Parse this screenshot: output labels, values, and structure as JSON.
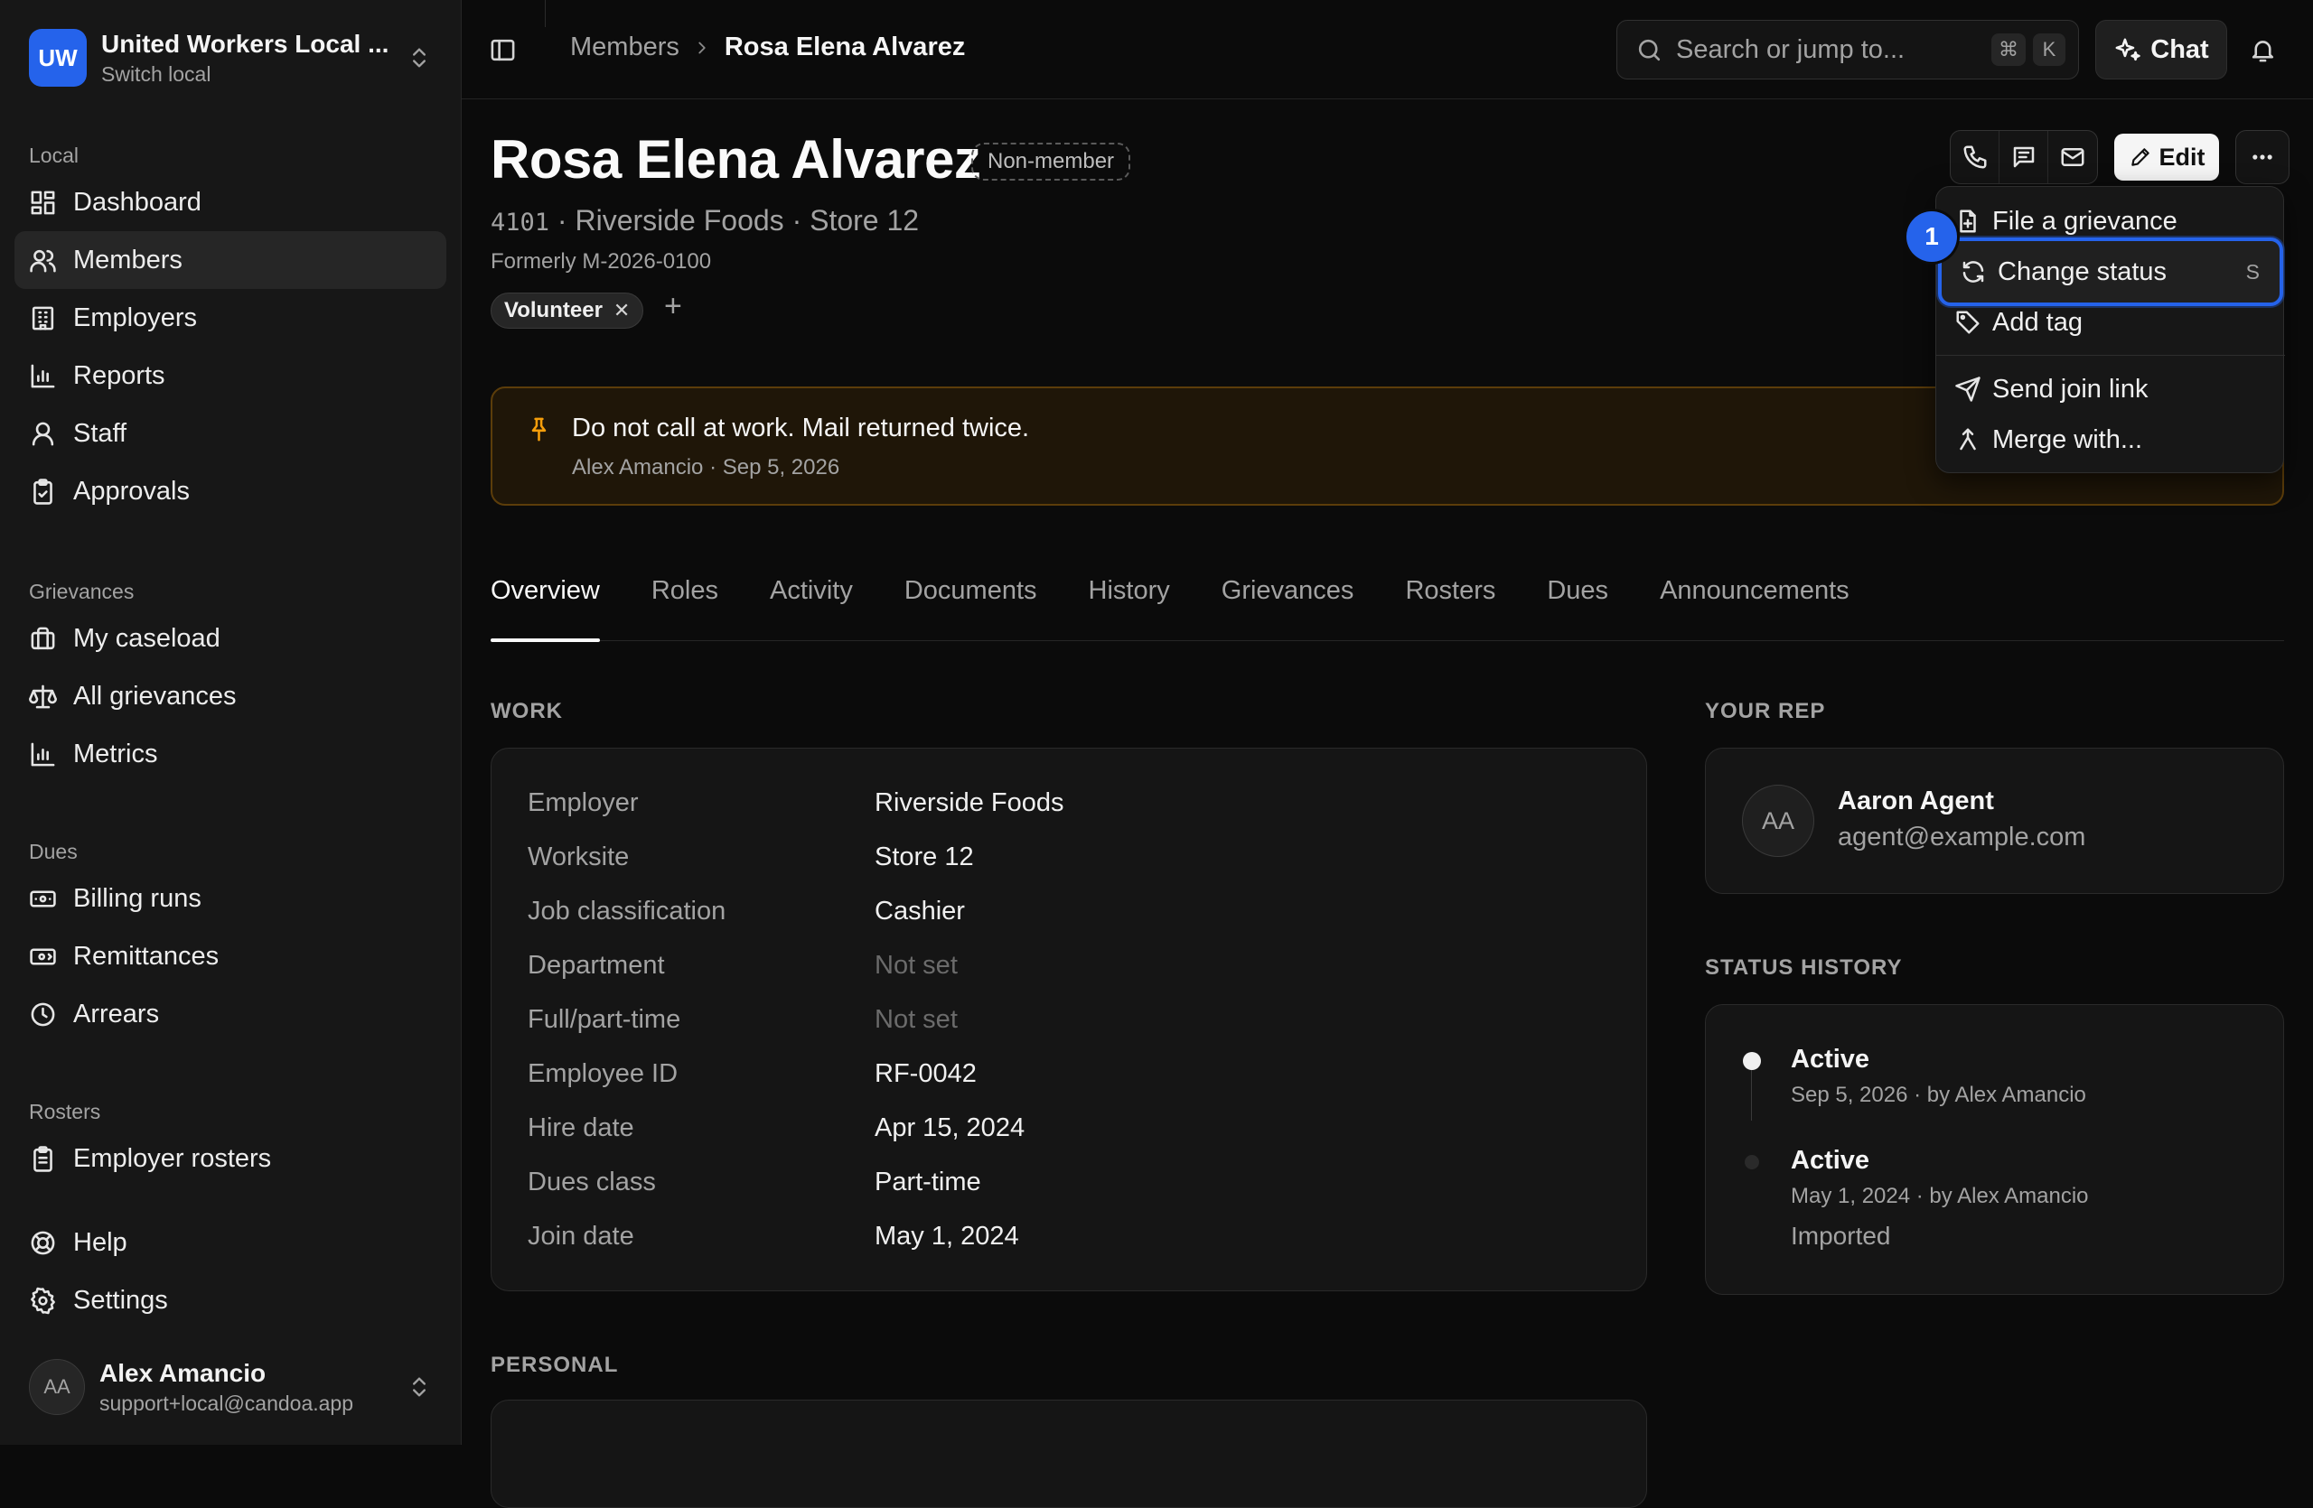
{
  "org": {
    "initials": "UW",
    "name": "United Workers Local ...",
    "subtitle": "Switch local"
  },
  "sidebar": {
    "groups": [
      {
        "heading": "Local",
        "items": [
          {
            "label": "Dashboard",
            "icon": "dashboard-icon"
          },
          {
            "label": "Members",
            "icon": "users-icon",
            "active": true
          },
          {
            "label": "Employers",
            "icon": "building-icon"
          },
          {
            "label": "Reports",
            "icon": "bar-chart-icon"
          },
          {
            "label": "Staff",
            "icon": "user-icon"
          },
          {
            "label": "Approvals",
            "icon": "clipboard-check-icon"
          }
        ]
      },
      {
        "heading": "Grievances",
        "items": [
          {
            "label": "My caseload",
            "icon": "briefcase-icon"
          },
          {
            "label": "All grievances",
            "icon": "scale-icon"
          },
          {
            "label": "Metrics",
            "icon": "bar-chart-icon"
          }
        ]
      },
      {
        "heading": "Dues",
        "items": [
          {
            "label": "Billing runs",
            "icon": "banknote-icon"
          },
          {
            "label": "Remittances",
            "icon": "banknote-arrow-icon"
          },
          {
            "label": "Arrears",
            "icon": "clock-icon"
          }
        ]
      },
      {
        "heading": "Rosters",
        "items": [
          {
            "label": "Employer rosters",
            "icon": "clipboard-list-icon"
          }
        ]
      }
    ],
    "footer_items": [
      {
        "label": "Help",
        "icon": "lifebuoy-icon"
      },
      {
        "label": "Settings",
        "icon": "gear-icon"
      }
    ],
    "user": {
      "initials": "AA",
      "name": "Alex Amancio",
      "email": "support+local@candoa.app"
    }
  },
  "topbar": {
    "breadcrumb": [
      "Members",
      "Rosa Elena Alvarez"
    ],
    "search_placeholder": "Search or jump to...",
    "search_keys": [
      "⌘",
      "K"
    ],
    "chat_label": "Chat"
  },
  "member": {
    "name": "Rosa Elena Alvarez",
    "status": "Non-member",
    "local_number": "4101",
    "employer_line": "· Riverside Foods · Store 12",
    "formerly": "Formerly M-2026-0100",
    "tags": [
      "Volunteer"
    ],
    "tag_add": "+",
    "edit_label": "Edit"
  },
  "note": {
    "text": "Do not call at work. Mail returned twice.",
    "meta": "Alex Amancio · Sep 5, 2026"
  },
  "tabs": [
    "Overview",
    "Roles",
    "Activity",
    "Documents",
    "History",
    "Grievances",
    "Rosters",
    "Dues",
    "Announcements"
  ],
  "active_tab": "Overview",
  "work": {
    "heading": "WORK",
    "fields": [
      {
        "label": "Employer",
        "value": "Riverside Foods"
      },
      {
        "label": "Worksite",
        "value": "Store 12"
      },
      {
        "label": "Job classification",
        "value": "Cashier"
      },
      {
        "label": "Department",
        "value": "Not set",
        "muted": true
      },
      {
        "label": "Full/part-time",
        "value": "Not set",
        "muted": true
      },
      {
        "label": "Employee ID",
        "value": "RF-0042"
      },
      {
        "label": "Hire date",
        "value": "Apr 15, 2024"
      },
      {
        "label": "Dues class",
        "value": "Part-time"
      },
      {
        "label": "Join date",
        "value": "May 1, 2024"
      }
    ]
  },
  "personal": {
    "heading": "PERSONAL"
  },
  "rep": {
    "heading": "YOUR REP",
    "initials": "AA",
    "name": "Aaron Agent",
    "email": "agent@example.com"
  },
  "status_history": {
    "heading": "STATUS HISTORY",
    "entries": [
      {
        "status": "Active",
        "meta": "Sep 5, 2026 · by Alex Amancio",
        "note": ""
      },
      {
        "status": "Active",
        "meta": "May 1, 2024 · by Alex Amancio",
        "note": "Imported"
      }
    ]
  },
  "menu": {
    "items": [
      {
        "label": "File a grievance",
        "icon": "file-plus-icon"
      },
      {
        "label": "Change status",
        "icon": "refresh-icon",
        "shortcut": "S",
        "highlighted": true
      },
      {
        "label": "Add tag",
        "icon": "tag-icon"
      },
      {
        "label": "Send join link",
        "icon": "send-icon"
      },
      {
        "label": "Merge with...",
        "icon": "merge-icon"
      }
    ],
    "annotation_badge": "1"
  },
  "colors": {
    "accent": "#2563eb",
    "note_border": "#5c3d0a",
    "pin": "#f59e0b"
  }
}
